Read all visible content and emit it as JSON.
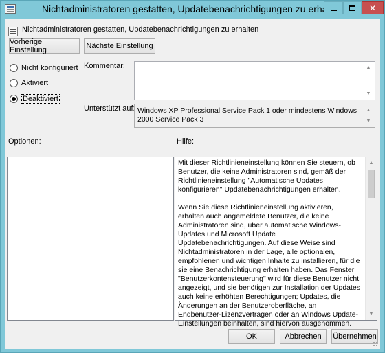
{
  "window": {
    "title": "Nichtadministratoren gestatten, Updatebenachrichtigungen zu erhalten",
    "controls": {
      "minimize": "minimize",
      "maximize": "maximize",
      "close": "✕"
    }
  },
  "setting": {
    "name": "Nichtadministratoren gestatten, Updatebenachrichtigungen zu erhalten"
  },
  "nav": {
    "previous_label": "Vorherige Einstellung",
    "next_label": "Nächste Einstellung"
  },
  "state_options": [
    {
      "label": "Nicht konfiguriert",
      "checked": false
    },
    {
      "label": "Aktiviert",
      "checked": false
    },
    {
      "label": "Deaktiviert",
      "checked": true
    }
  ],
  "comment": {
    "label": "Kommentar:",
    "value": ""
  },
  "supported": {
    "label": "Unterstützt auf:",
    "value": "Windows XP Professional Service Pack 1 oder mindestens Windows 2000 Service Pack 3"
  },
  "options": {
    "label": "Optionen:"
  },
  "help": {
    "label": "Hilfe:",
    "text": "Mit dieser Richtlinieneinstellung können Sie steuern, ob Benutzer, die keine Administratoren sind, gemäß der Richtlinieneinstellung \"Automatische Updates konfigurieren\" Updatebenachrichtigungen erhalten.\n\nWenn Sie diese Richtlinieneinstellung aktivieren, erhalten auch angemeldete Benutzer, die keine Administratoren sind, über automatische Windows-Updates und Microsoft Update Updatebenachrichtigungen. Auf diese Weise sind Nichtadministratoren in der Lage, alle optionalen, empfohlenen und wichtigen Inhalte zu installieren, für die sie eine Benachrichtigung erhalten haben. Das Fenster \"Benutzerkontensteuerung\" wird für diese Benutzer nicht angezeigt, und sie benötigen zur Installation der Updates auch keine erhöhten Berechtigungen; Updates, die Änderungen an der Benutzeroberfläche, an Endbenutzer-Lizenzverträgen oder an Windows Update-Einstellungen beinhalten, sind hiervon ausgenommen."
  },
  "footer": {
    "ok_label": "OK",
    "cancel_label": "Abbrechen",
    "apply_label": "Übernehmen"
  },
  "colors": {
    "titlebar": "#80c8d8",
    "close_button": "#c75050",
    "dialog_background": "#f0f0f0"
  }
}
